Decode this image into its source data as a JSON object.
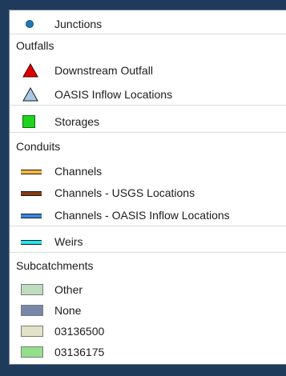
{
  "legend": {
    "junctions": {
      "label": "Junctions",
      "icon": "junction-circle-icon",
      "color": "#1f77b4"
    },
    "outfalls": {
      "heading": "Outfalls",
      "downstream": {
        "label": "Downstream Outfall",
        "icon": "red-triangle-icon",
        "color": "#e00000"
      },
      "oasis_inflow": {
        "label": "OASIS Inflow Locations",
        "icon": "light-blue-triangle-icon",
        "color": "#a9c8e8"
      }
    },
    "storages": {
      "label": "Storages",
      "icon": "green-square-icon",
      "color": "#1fd41f"
    },
    "conduits": {
      "heading": "Conduits",
      "channels": {
        "label": "Channels",
        "icon": "orange-line-icon",
        "color": "#f4b63c"
      },
      "usgs": {
        "label": "Channels - USGS Locations",
        "icon": "brown-line-icon",
        "color": "#8a3b10"
      },
      "oasis": {
        "label": "Channels - OASIS Inflow Locations",
        "icon": "blue-line-icon",
        "color": "#3a86e0"
      }
    },
    "weirs": {
      "label": "Weirs",
      "icon": "cyan-line-icon",
      "color": "#27e3f0"
    },
    "subcatchments": {
      "heading": "Subcatchments",
      "items": [
        {
          "label": "Other",
          "icon": "pale-green-swatch-icon",
          "color": "#bfdcbf"
        },
        {
          "label": "None",
          "icon": "slate-blue-swatch-icon",
          "color": "#7986a8"
        },
        {
          "label": "03136500",
          "icon": "beige-swatch-icon",
          "color": "#e2e2c6"
        },
        {
          "label": "03136175",
          "icon": "light-green-swatch-icon",
          "color": "#93e08b"
        }
      ]
    }
  }
}
